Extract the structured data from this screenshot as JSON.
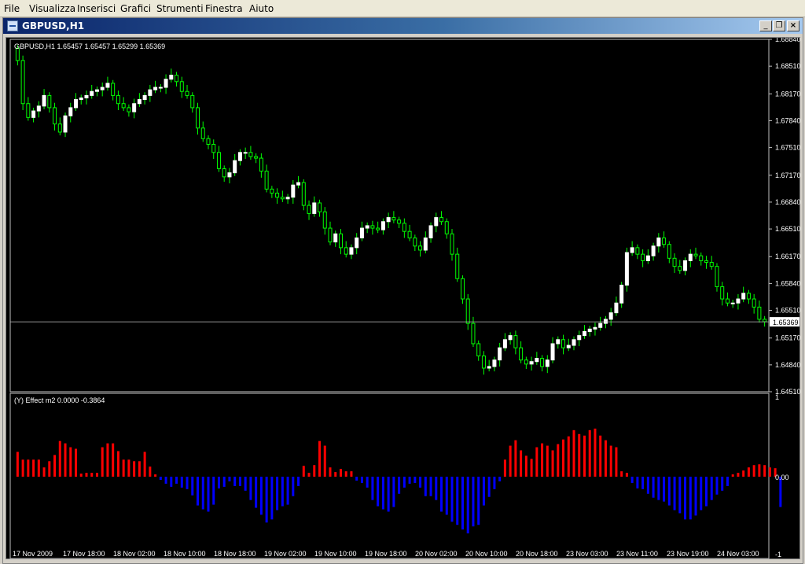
{
  "menu": [
    "File",
    "Visualizza",
    "Inserisci",
    "Grafici",
    "Strumenti",
    "Finestra",
    "Aiuto"
  ],
  "window": {
    "title": "GBPUSD,H1",
    "minimize_glyph": "_",
    "restore_glyph": "❐",
    "close_glyph": "×"
  },
  "main_chart": {
    "info": "GBPUSD,H1  1.65457 1.65457 1.65299 1.65369",
    "current_price_label": "1.65369",
    "price_labels": [
      "1.68840",
      "1.68510",
      "1.68170",
      "1.67840",
      "1.67510",
      "1.67170",
      "1.66840",
      "1.66510",
      "1.66170",
      "1.65840",
      "1.65510",
      "1.65170",
      "1.64840",
      "1.64510"
    ]
  },
  "indicator": {
    "info": "(Y) Effect m2  0.0000 -0.3864",
    "scale_labels": [
      "1",
      "0.00",
      "-1"
    ]
  },
  "time_labels": [
    "17 Nov 2009",
    "17 Nov 18:00",
    "18 Nov 02:00",
    "18 Nov 10:00",
    "18 Nov 18:00",
    "19 Nov 02:00",
    "19 Nov 10:00",
    "19 Nov 18:00",
    "20 Nov 02:00",
    "20 Nov 10:00",
    "20 Nov 18:00",
    "23 Nov 03:00",
    "23 Nov 11:00",
    "23 Nov 19:00",
    "24 Nov 03:00"
  ],
  "colors": {
    "bull": "#ffffff",
    "wick": "#00ff00",
    "positive": "#ff0000",
    "negative": "#0000ff",
    "grid": "#c0c0c0"
  },
  "chart_data": {
    "type": "candlestick",
    "symbol": "GBPUSD",
    "timeframe": "H1",
    "ylim": [
      1.6451,
      1.6884
    ],
    "close": [
      1.6858,
      1.6805,
      1.6788,
      1.6796,
      1.6802,
      1.6815,
      1.68,
      1.678,
      1.677,
      1.679,
      1.68,
      1.681,
      1.6812,
      1.6815,
      1.682,
      1.6822,
      1.6825,
      1.683,
      1.6815,
      1.6805,
      1.68,
      1.6795,
      1.6805,
      1.681,
      1.6815,
      1.6822,
      1.6825,
      1.6825,
      1.6835,
      1.684,
      1.6832,
      1.682,
      1.6815,
      1.68,
      1.6775,
      1.6762,
      1.6755,
      1.6745,
      1.6725,
      1.6715,
      1.672,
      1.6735,
      1.6745,
      1.6745,
      1.674,
      1.6738,
      1.6722,
      1.67,
      1.6695,
      1.669,
      1.6688,
      1.669,
      1.6705,
      1.6708,
      1.668,
      1.667,
      1.6683,
      1.6672,
      1.6652,
      1.6635,
      1.6645,
      1.6628,
      1.662,
      1.6628,
      1.664,
      1.6652,
      1.6655,
      1.6652,
      1.665,
      1.666,
      1.6665,
      1.6662,
      1.6658,
      1.6648,
      1.664,
      1.663,
      1.6625,
      1.664,
      1.6655,
      1.6665,
      1.666,
      1.6645,
      1.662,
      1.659,
      1.6565,
      1.6535,
      1.651,
      1.6495,
      1.648,
      1.6482,
      1.649,
      1.6505,
      1.6515,
      1.652,
      1.6505,
      1.649,
      1.6485,
      1.6488,
      1.6492,
      1.6482,
      1.649,
      1.651,
      1.6515,
      1.6505,
      1.6508,
      1.6515,
      1.652,
      1.6525,
      1.6528,
      1.653,
      1.6535,
      1.654,
      1.6548,
      1.656,
      1.6582,
      1.6622,
      1.6628,
      1.662,
      1.6612,
      1.6618,
      1.663,
      1.664,
      1.6632,
      1.6615,
      1.6605,
      1.66,
      1.6612,
      1.662,
      1.6618,
      1.6612,
      1.661,
      1.6605,
      1.658,
      1.6565,
      1.656,
      1.656,
      1.6565,
      1.6572,
      1.6565,
      1.6555,
      1.654,
      1.6537
    ],
    "effect_m2": [
      0.32,
      0.22,
      0.22,
      0.22,
      0.22,
      0.12,
      0.2,
      0.28,
      0.46,
      0.43,
      0.38,
      0.36,
      0.04,
      0.05,
      0.05,
      0.05,
      0.38,
      0.43,
      0.43,
      0.33,
      0.22,
      0.22,
      0.2,
      0.2,
      0.32,
      0.13,
      0.03,
      -0.04,
      -0.09,
      -0.13,
      -0.09,
      -0.14,
      -0.16,
      -0.24,
      -0.37,
      -0.42,
      -0.45,
      -0.36,
      -0.15,
      -0.13,
      -0.06,
      -0.12,
      -0.12,
      -0.18,
      -0.3,
      -0.4,
      -0.49,
      -0.59,
      -0.55,
      -0.43,
      -0.38,
      -0.36,
      -0.25,
      -0.12,
      0.14,
      0.05,
      0.15,
      0.46,
      0.4,
      0.12,
      0.06,
      0.1,
      0.07,
      0.07,
      -0.05,
      -0.08,
      -0.14,
      -0.3,
      -0.38,
      -0.42,
      -0.45,
      -0.39,
      -0.22,
      -0.14,
      -0.09,
      -0.08,
      -0.14,
      -0.25,
      -0.25,
      -0.3,
      -0.45,
      -0.49,
      -0.58,
      -0.62,
      -0.68,
      -0.73,
      -0.64,
      -0.62,
      -0.37,
      -0.26,
      -0.16,
      -0.06,
      0.22,
      0.4,
      0.47,
      0.34,
      0.27,
      0.23,
      0.38,
      0.43,
      0.4,
      0.34,
      0.42,
      0.48,
      0.52,
      0.6,
      0.55,
      0.53,
      0.6,
      0.62,
      0.53,
      0.47,
      0.4,
      0.38,
      0.07,
      0.05,
      -0.08,
      -0.15,
      -0.16,
      -0.22,
      -0.27,
      -0.3,
      -0.32,
      -0.37,
      -0.43,
      -0.47,
      -0.55,
      -0.55,
      -0.5,
      -0.43,
      -0.38,
      -0.3,
      -0.23,
      -0.18,
      -0.12,
      0.03,
      0.05,
      0.08,
      0.12,
      0.15,
      0.16,
      0.15,
      0.12,
      0.11,
      -0.39
    ]
  }
}
